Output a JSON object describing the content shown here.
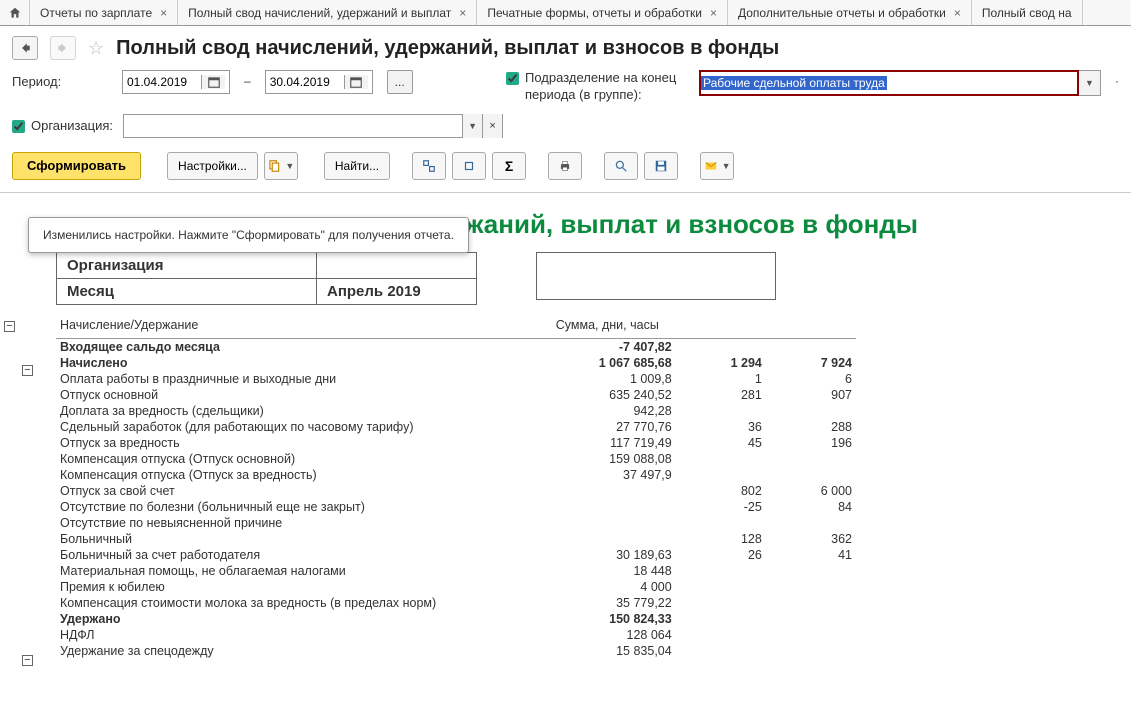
{
  "tabs": [
    {
      "label": "Отчеты по зарплате"
    },
    {
      "label": "Полный свод начислений, удержаний и выплат"
    },
    {
      "label": "Печатные формы, отчеты и обработки"
    },
    {
      "label": "Дополнительные отчеты и обработки"
    },
    {
      "label": "Полный свод на"
    }
  ],
  "page_title": "Полный свод начислений, удержаний, выплат и взносов в фонды",
  "period_label": "Период:",
  "date_from": "01.04.2019",
  "date_to": "30.04.2019",
  "dash": "–",
  "dept_checkbox_label": "Подразделение на конец периода (в группе):",
  "dept_value": "Рабочие сдельной оплаты труда",
  "org_checkbox_label": "Организация:",
  "toolbar": {
    "form": "Сформировать",
    "settings": "Настройки...",
    "find": "Найти..."
  },
  "notice": "Изменились настройки. Нажмите \"Сформировать\" для получения отчета.",
  "report_title_part": "ержаний, выплат и взносов в фонды",
  "meta": {
    "org_label": "Организация",
    "month_label": "Месяц",
    "month_value": "Апрель 2019"
  },
  "headers": {
    "col1": "Начисление/Удержание",
    "col2": "Сумма, дни, часы"
  },
  "rows": [
    {
      "section": true,
      "name": "Входящее сальдо месяца",
      "v1": "-7 407,82",
      "v2": "",
      "v3": ""
    },
    {
      "section": true,
      "name": "Начислено",
      "v1": "1 067 685,68",
      "v2": "1 294",
      "v3": "7 924"
    },
    {
      "name": "Оплата работы в праздничные и выходные дни",
      "v1": "1 009,8",
      "v2": "1",
      "v3": "6"
    },
    {
      "name": "Отпуск основной",
      "v1": "635 240,52",
      "v2": "281",
      "v3": "907"
    },
    {
      "name": "Доплата за вредность (сдельщики)",
      "v1": "942,28",
      "v2": "",
      "v3": ""
    },
    {
      "name": "Сдельный заработок (для работающих по часовому тарифу)",
      "v1": "27 770,76",
      "v2": "36",
      "v3": "288"
    },
    {
      "name": "Отпуск за вредность",
      "v1": "117 719,49",
      "v2": "45",
      "v3": "196"
    },
    {
      "name": "Компенсация отпуска (Отпуск основной)",
      "v1": "159 088,08",
      "v2": "",
      "v3": ""
    },
    {
      "name": "Компенсация отпуска (Отпуск за вредность)",
      "v1": "37 497,9",
      "v2": "",
      "v3": ""
    },
    {
      "name": "Отпуск за свой счет",
      "v1": "",
      "v2": "802",
      "v3": "6 000"
    },
    {
      "name": "Отсутствие по болезни (больничный еще не закрыт)",
      "v1": "",
      "v2": "-25",
      "v3": "84"
    },
    {
      "name": "Отсутствие по невыясненной причине",
      "v1": "",
      "v2": "",
      "v3": ""
    },
    {
      "name": "Больничный",
      "v1": "",
      "v2": "128",
      "v3": "362"
    },
    {
      "name": "Больничный за счет работодателя",
      "v1": "30 189,63",
      "v2": "26",
      "v3": "41"
    },
    {
      "name": "Материальная помощь, не облагаемая налогами",
      "v1": "18 448",
      "v2": "",
      "v3": ""
    },
    {
      "name": "Премия к юбилею",
      "v1": "4 000",
      "v2": "",
      "v3": ""
    },
    {
      "name": "Компенсация стоимости молока за вредность (в пределах норм)",
      "v1": "35 779,22",
      "v2": "",
      "v3": ""
    },
    {
      "section": true,
      "name": "Удержано",
      "v1": "150 824,33",
      "v2": "",
      "v3": ""
    },
    {
      "name": "НДФЛ",
      "v1": "128 064",
      "v2": "",
      "v3": ""
    },
    {
      "name": "Удержание за спецодежду",
      "v1": "15 835,04",
      "v2": "",
      "v3": ""
    }
  ]
}
